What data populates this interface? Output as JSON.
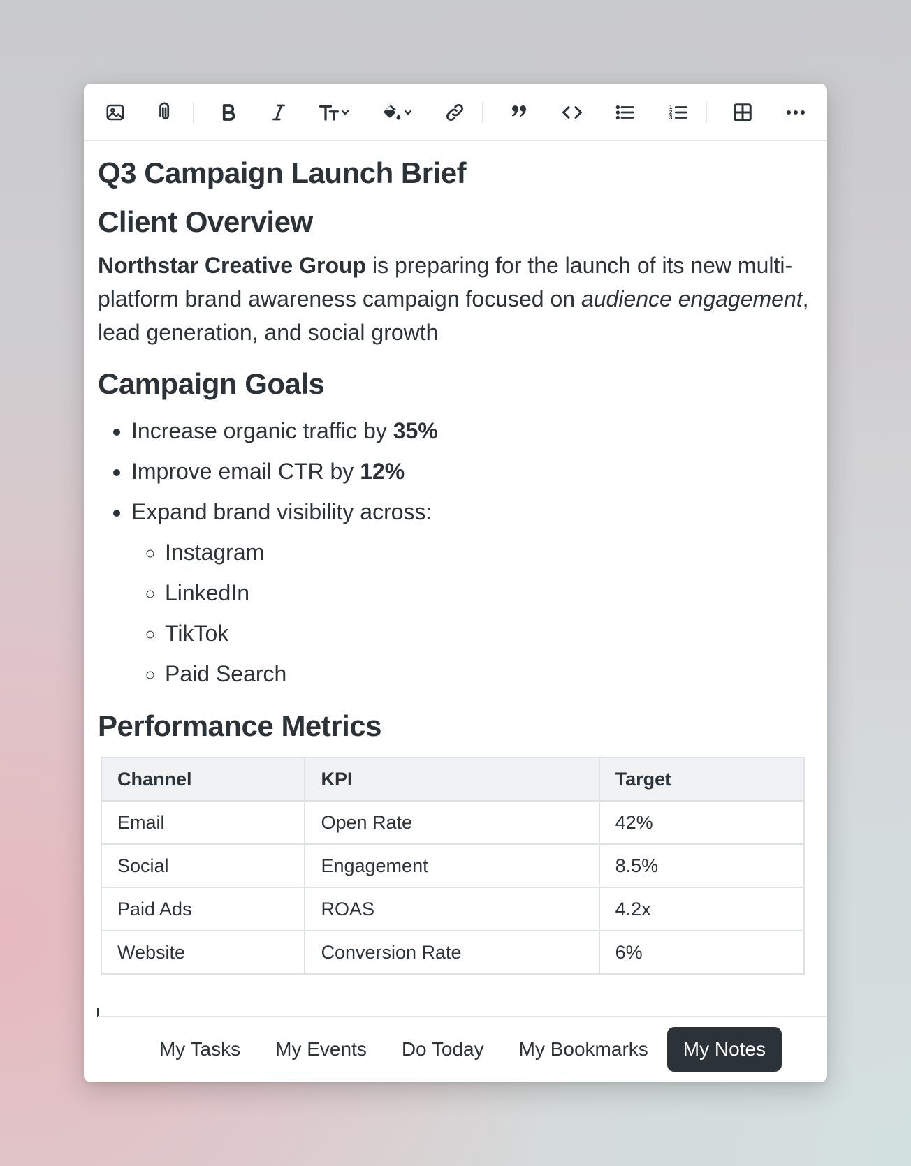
{
  "toolbar": {
    "buttons": [
      {
        "name": "image-icon"
      },
      {
        "name": "paperclip-icon"
      },
      {
        "name": "bold-icon"
      },
      {
        "name": "italic-icon"
      },
      {
        "name": "text-size-icon"
      },
      {
        "name": "paint-bucket-icon"
      },
      {
        "name": "link-icon"
      },
      {
        "name": "quote-icon"
      },
      {
        "name": "code-icon"
      },
      {
        "name": "bullet-list-icon"
      },
      {
        "name": "numbered-list-icon"
      },
      {
        "name": "table-icon"
      },
      {
        "name": "more-icon"
      }
    ]
  },
  "document": {
    "title": "Q3 Campaign Launch Brief",
    "client_heading": "Client Overview",
    "client_bold": "Northstar Creative Group",
    "client_text_1": " is preparing for the launch of its new multi-platform brand awareness campaign focused on ",
    "client_italic": "audience engagement",
    "client_text_2": ", lead generation, and social growth",
    "goals_heading": "Campaign Goals",
    "goals": [
      {
        "text": "Increase organic traffic by ",
        "bold": "35%"
      },
      {
        "text": "Improve email CTR by ",
        "bold": "12%"
      },
      {
        "text": "Expand brand visibility across:"
      }
    ],
    "channels": [
      "Instagram",
      "LinkedIn",
      "TikTok",
      "Paid Search"
    ],
    "metrics_heading": "Performance Metrics",
    "metrics_table": {
      "headers": [
        "Channel",
        "KPI",
        "Target"
      ],
      "rows": [
        [
          "Email",
          "Open Rate",
          "42%"
        ],
        [
          "Social",
          "Engagement",
          "8.5%"
        ],
        [
          "Paid Ads",
          "ROAS",
          "4.2x"
        ],
        [
          "Website",
          "Conversion Rate",
          "6%"
        ]
      ]
    }
  },
  "nav": {
    "items": [
      "My Tasks",
      "My Events",
      "Do Today",
      "My Bookmarks",
      "My Notes"
    ],
    "active": "My Notes"
  }
}
